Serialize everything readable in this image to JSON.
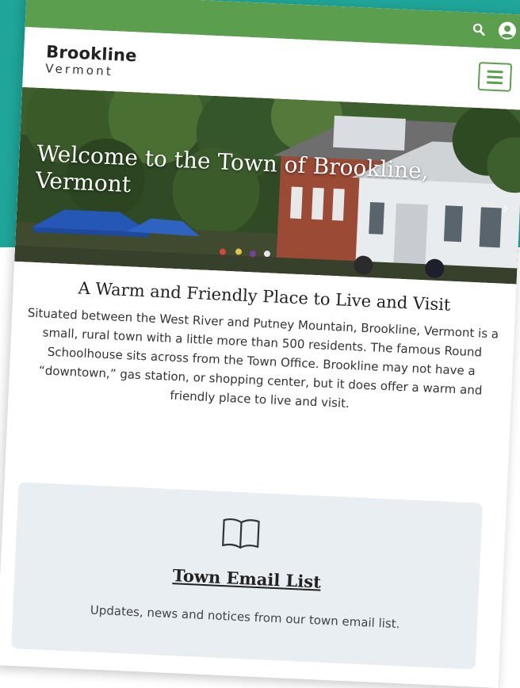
{
  "site": {
    "name": "Brookline",
    "subname": "Vermont"
  },
  "topbar": {
    "search_icon": "search-icon",
    "account_icon": "user-circle-icon",
    "color": "#5b9e4e"
  },
  "hero": {
    "title": "Welcome to the Town of Brookline, Vermont",
    "next_icon": "chevron-right-icon"
  },
  "intro": {
    "heading": "A Warm and Friendly Place to Live and Visit",
    "body": "Situated between the West River and Putney Mountain, Brookline, Vermont is a small, rural town with a little more than 500 residents. The famous Round Schoolhouse sits across from the Town Office. Brookline may not have a “downtown,” gas station, or shopping center, but it does offer a warm and friendly place to live and visit."
  },
  "card": {
    "icon": "book-open-icon",
    "title": "Town Email List",
    "description": "Updates, news and notices from our town email list."
  },
  "colors": {
    "background": "#1fa599",
    "accent": "#5b9e4e",
    "card": "#e9eef2"
  }
}
